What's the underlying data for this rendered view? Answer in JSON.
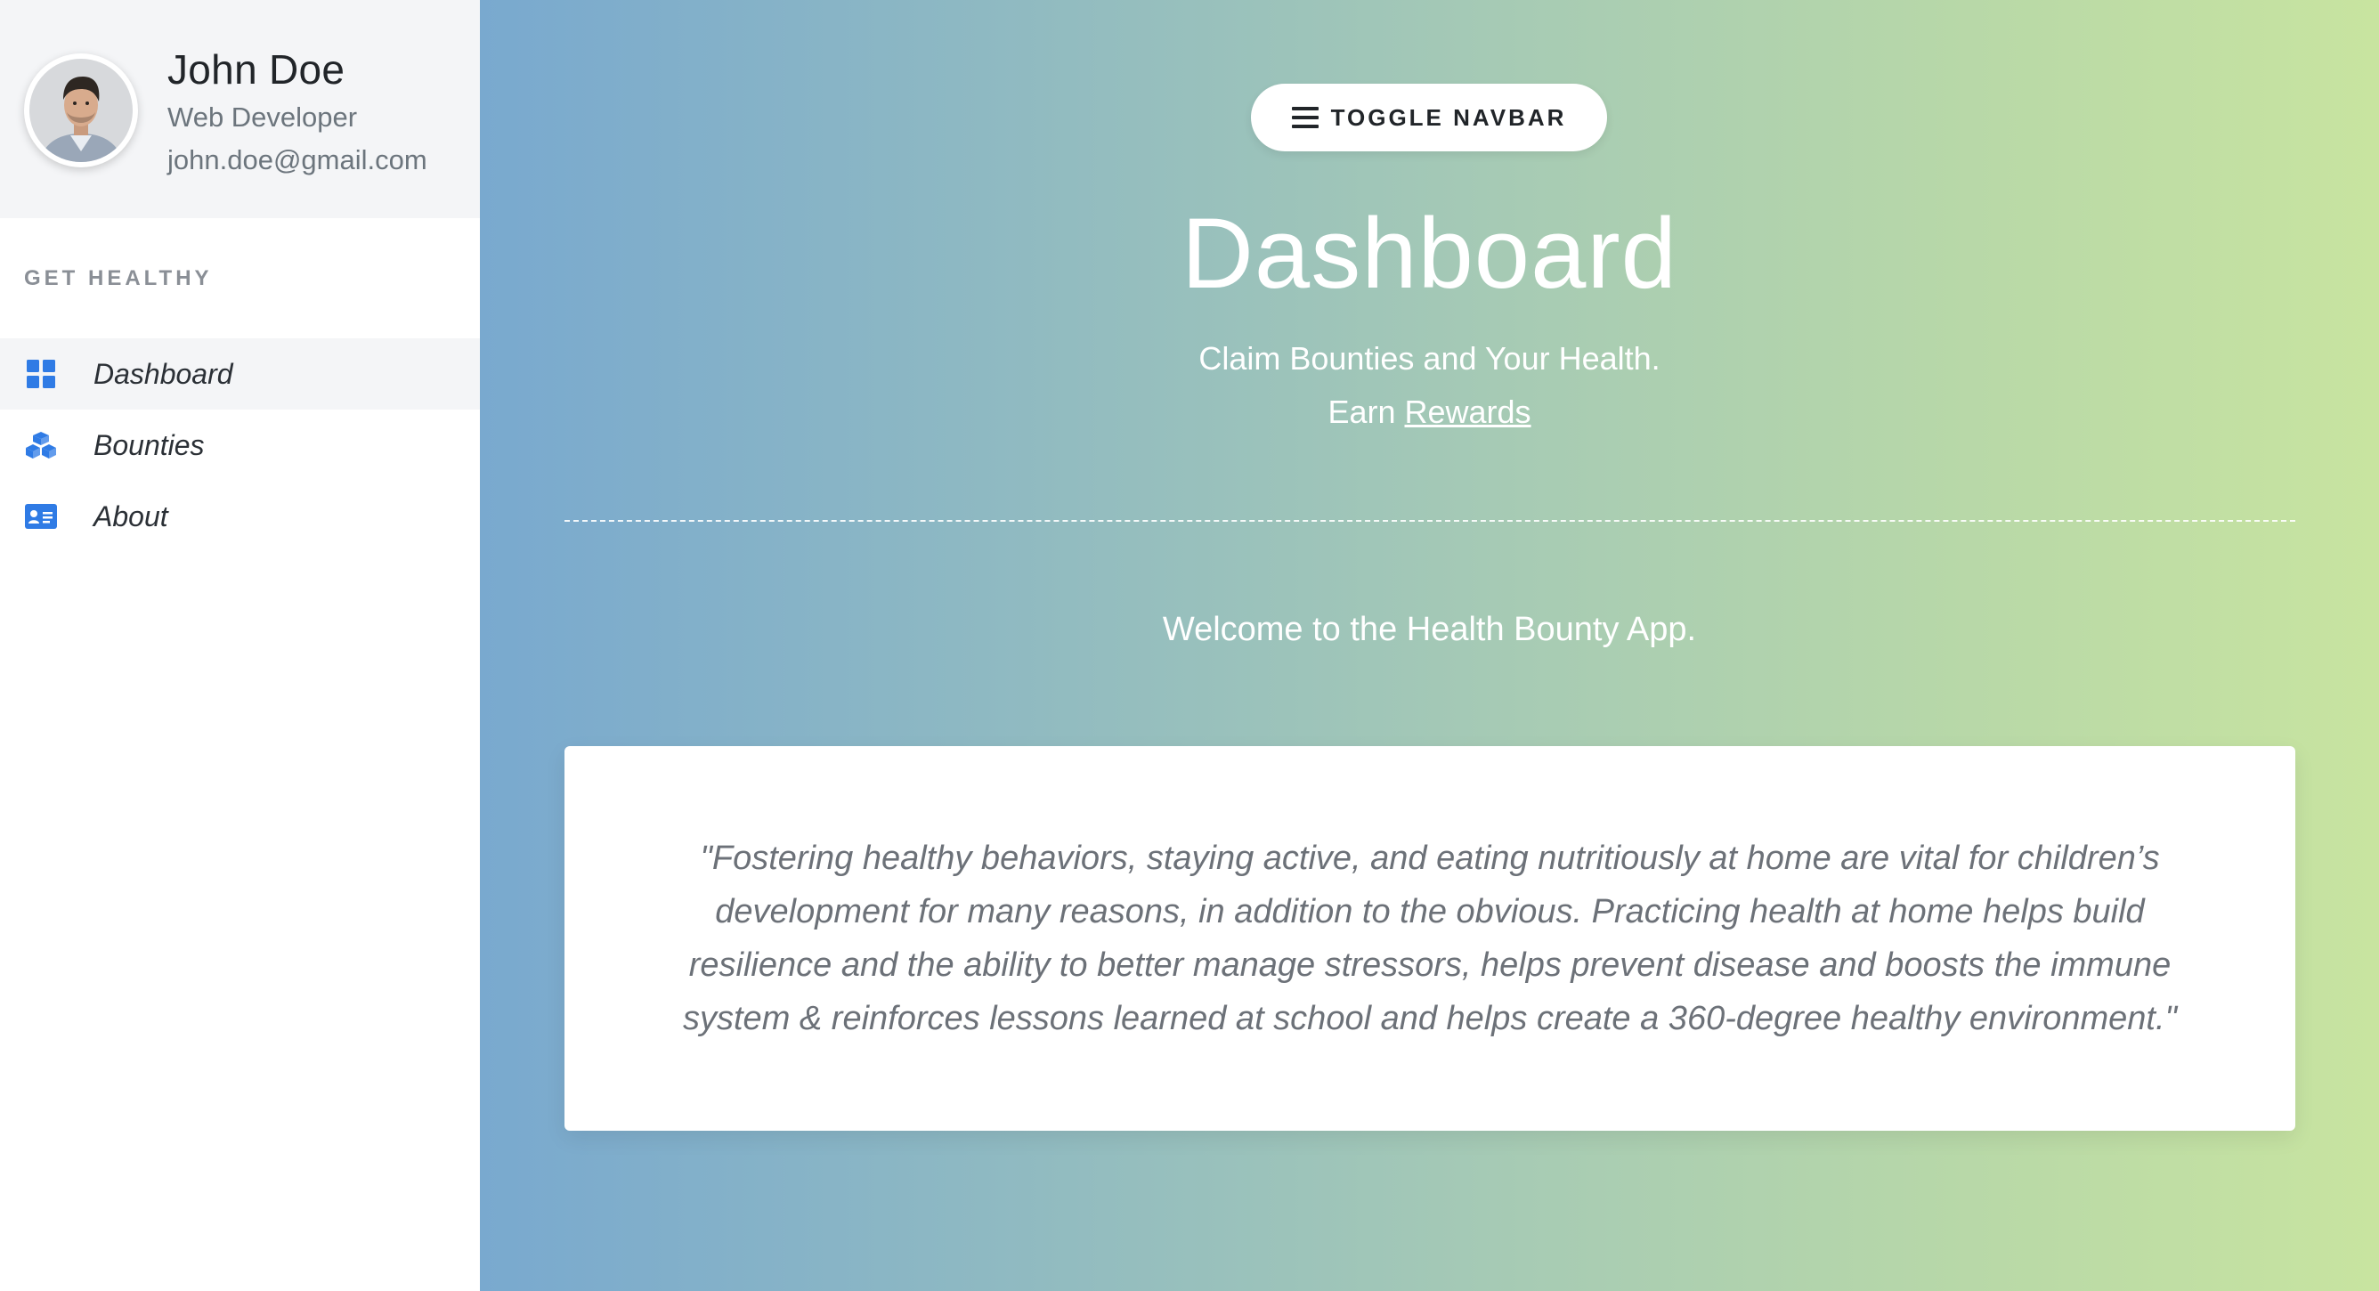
{
  "profile": {
    "name": "John Doe",
    "role": "Web Developer",
    "email": "john.doe@gmail.com"
  },
  "sidebar": {
    "section_heading": "GET HEALTHY",
    "items": [
      {
        "label": "Dashboard",
        "icon": "dashboard-grid-icon",
        "active": true
      },
      {
        "label": "Bounties",
        "icon": "cubes-icon",
        "active": false
      },
      {
        "label": "About",
        "icon": "id-card-icon",
        "active": false
      }
    ]
  },
  "header": {
    "toggle_label": "TOGGLE NAVBAR",
    "toggle_icon": "hamburger-icon",
    "title": "Dashboard",
    "subtitle_line1": "Claim Bounties and Your Health.",
    "subtitle_earn": "Earn",
    "subtitle_link": "Rewards"
  },
  "main": {
    "welcome": "Welcome to the Health Bounty App.",
    "quote": "\"Fostering healthy behaviors, staying active, and eating nutritiously at home are vital for children’s development for many reasons, in addition to the obvious. Practicing health at home helps build resilience and the ability to better manage stressors, helps prevent disease and boosts the immune system & reinforces lessons learned at school and helps create a 360-degree healthy environment.\""
  },
  "colors": {
    "accent_icon": "#2f7be5",
    "gradient_start": "#79a9cf",
    "gradient_end": "#c8e4a0",
    "sidebar_active_bg": "#f4f5f7"
  }
}
